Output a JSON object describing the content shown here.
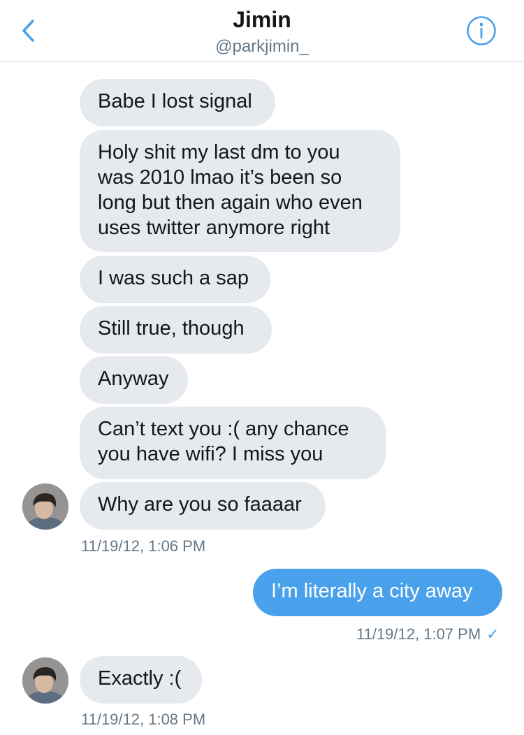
{
  "header": {
    "title": "Jimin",
    "handle": "@parkjimin_",
    "back_icon": "chevron-left-icon",
    "info_icon": "info-icon",
    "accent_color": "#4aa1eb"
  },
  "messages": [
    {
      "from": "them",
      "text": "Babe I lost signal"
    },
    {
      "from": "them",
      "lines": [
        "Holy shit my last dm to you",
        "was 2010 lmao it’s been so",
        "long but then again who even",
        "uses twitter anymore right"
      ]
    },
    {
      "from": "them",
      "text": "I was such a sap"
    },
    {
      "from": "them",
      "text": "Still true, though"
    },
    {
      "from": "them",
      "text": "Anyway"
    },
    {
      "from": "them",
      "lines": [
        "Can’t text you :( any chance",
        "you have wifi? I miss you"
      ]
    },
    {
      "from": "them",
      "text": "Why are you so faaaar",
      "timestamp": "11/19/12, 1:06 PM"
    },
    {
      "from": "me",
      "text": "I’m literally a city away",
      "timestamp": "11/19/12, 1:07 PM",
      "read_icon": "checkmark-icon"
    },
    {
      "from": "them",
      "text": "Exactly :(",
      "timestamp": "11/19/12, 1:08 PM"
    }
  ],
  "colors": {
    "received_bubble": "#e6e9ee",
    "sent_bubble": "#4aa1eb",
    "timestamp": "#657786"
  }
}
